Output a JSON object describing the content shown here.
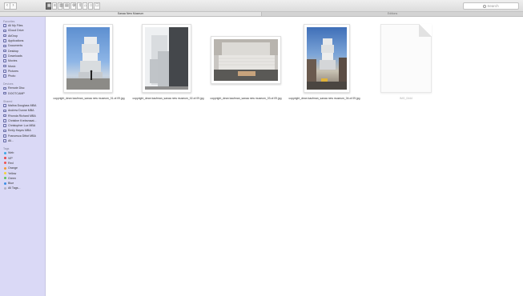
{
  "toolbar": {
    "nav": [
      "‹",
      "›"
    ],
    "views": [
      "▦",
      "≡",
      "▥",
      "▤",
      "⚙",
      "⇪",
      "⌂",
      "○",
      "☐"
    ],
    "search_placeholder": "Search"
  },
  "tabs": [
    {
      "label": "Sanaa New Museum",
      "active": true
    },
    {
      "label": "Editions",
      "active": false
    }
  ],
  "sidebar": {
    "favorites_header": "Favorites",
    "favorites": [
      {
        "label": "All My Files",
        "icon": "all-files-icon"
      },
      {
        "label": "iCloud Drive",
        "icon": "cloud-icon"
      },
      {
        "label": "AirDrop",
        "icon": "airdrop-icon"
      },
      {
        "label": "Applications",
        "icon": "applications-icon"
      },
      {
        "label": "Documents",
        "icon": "document-icon"
      },
      {
        "label": "Desktop",
        "icon": "desktop-icon"
      },
      {
        "label": "Downloads",
        "icon": "download-icon"
      },
      {
        "label": "Movies",
        "icon": "movie-icon"
      },
      {
        "label": "Music",
        "icon": "music-icon"
      },
      {
        "label": "Pictures",
        "icon": "picture-icon"
      },
      {
        "label": "Photo",
        "icon": "folder-icon"
      }
    ],
    "devices_header": "Devices",
    "devices": [
      {
        "label": "Remote Disc",
        "icon": "disc-icon"
      },
      {
        "label": "DOOTCAMP",
        "icon": "drive-icon"
      }
    ],
    "shared_header": "Shared",
    "shared": [
      {
        "label": "Malina Douglass MBA",
        "icon": "computer-icon"
      },
      {
        "label": "Andrew Dunne MBA",
        "icon": "computer-icon"
      },
      {
        "label": "Rhonda Richard MBA",
        "icon": "computer-icon"
      },
      {
        "label": "Christine Krebsmaat...",
        "icon": "computer-icon"
      },
      {
        "label": "Christopher Lux MBA",
        "icon": "computer-icon"
      },
      {
        "label": "Emily Hayes MBA",
        "icon": "computer-icon"
      },
      {
        "label": "Francesca Dittot MBA",
        "icon": "computer-icon"
      },
      {
        "label": "All...",
        "icon": "globe-icon"
      }
    ],
    "tags_header": "Tags",
    "tags": [
      {
        "label": "Web",
        "color": "#3ba7e6"
      },
      {
        "label": "VIP",
        "color": "#e8474a"
      },
      {
        "label": "Red",
        "color": "#f0524f"
      },
      {
        "label": "Orange",
        "color": "#f39b34"
      },
      {
        "label": "Yellow",
        "color": "#f4d03a"
      },
      {
        "label": "Green",
        "color": "#5cc45a"
      },
      {
        "label": "Blue",
        "color": "#3b8ee6"
      },
      {
        "label": "All Tags...",
        "color": "#b0b0c0"
      }
    ]
  },
  "files": [
    {
      "name": "copyright_dean kaufman_sanaa new museum_01.of.09.jpg",
      "kind": "photo-portrait"
    },
    {
      "name": "copyright_dean kaufman_sanaa new museum_02.of.09.jpg",
      "kind": "photo-portrait"
    },
    {
      "name": "copyright_dean kaufman_sanaa new museum_03.of.09.jpg",
      "kind": "photo-landscape"
    },
    {
      "name": "copyright_dean kaufman_sanaa new museum_04.of.09.jpg",
      "kind": "photo-portrait"
    },
    {
      "name": "IMG_0444",
      "kind": "document"
    }
  ],
  "colors": {
    "sidebar_bg": "#dad9f6",
    "toolbar_bg": "#e6e6e6",
    "content_bg": "#ffffff"
  }
}
